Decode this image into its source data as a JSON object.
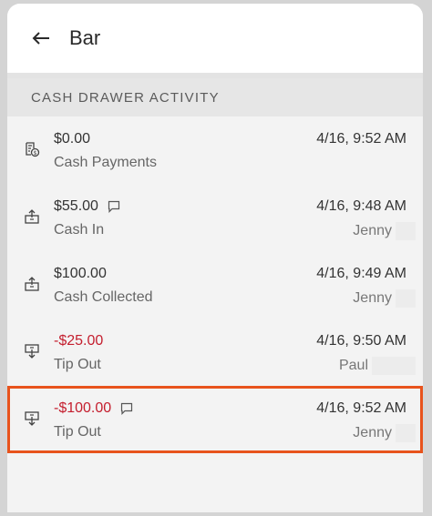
{
  "header": {
    "title": "Bar"
  },
  "section": {
    "title": "CASH DRAWER ACTIVITY"
  },
  "entries": [
    {
      "amount": "$0.00",
      "label": "Cash Payments",
      "time": "4/16, 9:52 AM",
      "user": ""
    },
    {
      "amount": "$55.00",
      "label": "Cash In",
      "time": "4/16, 9:48 AM",
      "user": "Jenny"
    },
    {
      "amount": "$100.00",
      "label": "Cash Collected",
      "time": "4/16, 9:49 AM",
      "user": "Jenny"
    },
    {
      "amount": "-$25.00",
      "label": "Tip Out",
      "time": "4/16, 9:50 AM",
      "user": "Paul"
    },
    {
      "amount": "-$100.00",
      "label": "Tip Out",
      "time": "4/16, 9:52 AM",
      "user": "Jenny"
    }
  ],
  "colors": {
    "accent_highlight": "#e8531c",
    "negative_amount": "#c41e2e"
  },
  "icons": {
    "back": "back-arrow-icon",
    "cash_payments": "receipt-cash-icon",
    "cash_in": "drawer-in-icon",
    "cash_out": "drawer-out-icon",
    "comment": "comment-icon"
  }
}
